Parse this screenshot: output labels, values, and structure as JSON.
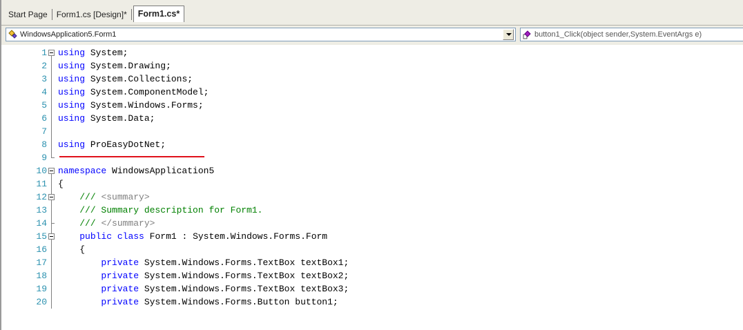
{
  "tabs": [
    {
      "label": "Start Page",
      "active": false
    },
    {
      "label": "Form1.cs [Design]*",
      "active": false
    },
    {
      "label": "Form1.cs*",
      "active": true
    }
  ],
  "navbar": {
    "left_combo": "WindowsApplication5.Form1",
    "right_combo": "button1_Click(object sender,System.EventArgs e)"
  },
  "code": {
    "lines": [
      {
        "n": "1",
        "text": "using System;"
      },
      {
        "n": "2",
        "text": "using System.Drawing;"
      },
      {
        "n": "3",
        "text": "using System.Collections;"
      },
      {
        "n": "4",
        "text": "using System.ComponentModel;"
      },
      {
        "n": "5",
        "text": "using System.Windows.Forms;"
      },
      {
        "n": "6",
        "text": "using System.Data;"
      },
      {
        "n": "7",
        "text": ""
      },
      {
        "n": "8",
        "text": "using ProEasyDotNet;"
      },
      {
        "n": "9",
        "text": ""
      },
      {
        "n": "10",
        "text": "namespace WindowsApplication5"
      },
      {
        "n": "11",
        "text": "{"
      },
      {
        "n": "12",
        "text": "    /// <summary>"
      },
      {
        "n": "13",
        "text": "    /// Summary description for Form1."
      },
      {
        "n": "14",
        "text": "    /// </summary>"
      },
      {
        "n": "15",
        "text": "    public class Form1 : System.Windows.Forms.Form"
      },
      {
        "n": "16",
        "text": "    {"
      },
      {
        "n": "17",
        "text": "        private System.Windows.Forms.TextBox textBox1;"
      },
      {
        "n": "18",
        "text": "        private System.Windows.Forms.TextBox textBox2;"
      },
      {
        "n": "19",
        "text": "        private System.Windows.Forms.TextBox textBox3;"
      },
      {
        "n": "20",
        "text": "        private System.Windows.Forms.Button button1;"
      }
    ]
  },
  "colors": {
    "keyword": "#0000ff",
    "comment": "#008000",
    "line_number": "#2b91af",
    "highlight_underline": "#e0101a"
  }
}
